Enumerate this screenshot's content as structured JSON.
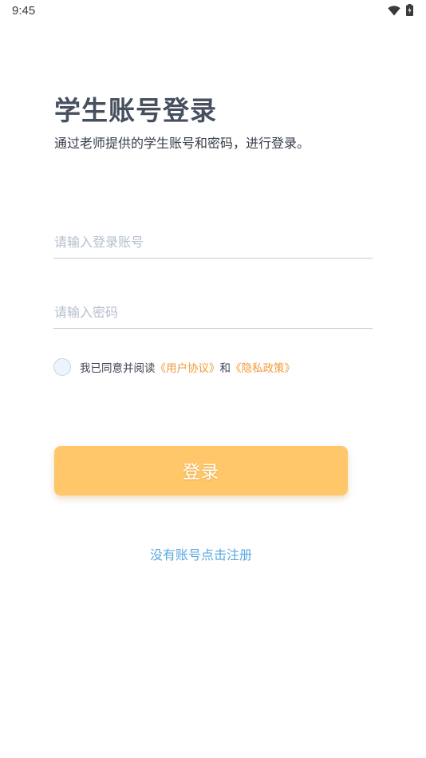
{
  "status_bar": {
    "time": "9:45",
    "icons": [
      "wifi-icon",
      "battery-icon"
    ]
  },
  "header": {
    "title": "学生账号登录",
    "subtitle": "通过老师提供的学生账号和密码，进行登录。"
  },
  "form": {
    "account_placeholder": "请输入登录账号",
    "password_placeholder": "请输入密码",
    "agreement": {
      "prefix": "我已同意并阅读",
      "terms_link": "《用户协议》",
      "conjunction": "和",
      "privacy_link": "《隐私政策》",
      "checked": false
    },
    "login_label": "登录"
  },
  "footer": {
    "register_label": "没有账号点击注册"
  },
  "colors": {
    "accent": "#ffc76a",
    "link_orange": "#f29a3a",
    "link_blue": "#5aa8e0"
  }
}
